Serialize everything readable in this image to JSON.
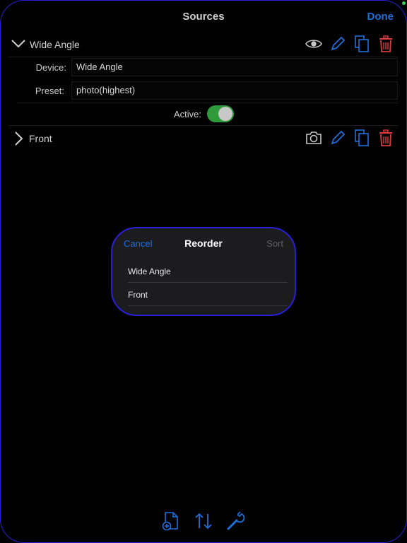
{
  "header": {
    "title": "Sources",
    "done_label": "Done"
  },
  "sources": [
    {
      "name": "Wide Angle",
      "expanded": true,
      "device_label": "Device:",
      "device_value": "Wide Angle",
      "preset_label": "Preset:",
      "preset_value": "photo(highest)",
      "active_label": "Active:",
      "active": true
    },
    {
      "name": "Front",
      "expanded": false
    }
  ],
  "dialog": {
    "cancel_label": "Cancel",
    "title": "Reorder",
    "sort_label": "Sort",
    "items": [
      "Wide Angle",
      "Front"
    ]
  },
  "icons": {
    "eye": "eye-icon",
    "pencil": "pencil-icon",
    "copy": "copy-icon",
    "trash": "trash-icon",
    "camera": "camera-icon",
    "add_doc": "add-document-icon",
    "reorder": "reorder-icon",
    "wrench": "wrench-icon"
  },
  "colors": {
    "accent": "#1e6fd9",
    "destructive": "#d83a3a",
    "toggle_on": "#2f9a3a",
    "frame": "#2a1fd6"
  }
}
